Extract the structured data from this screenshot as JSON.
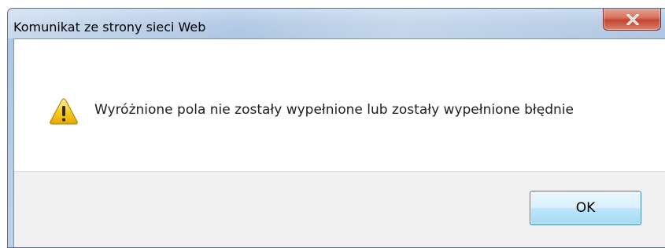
{
  "dialog": {
    "title": "Komunikat ze strony sieci Web",
    "message": "Wyróżnione pola nie zostały wypełnione lub zostały wypełnione błędnie",
    "icon": "warning-icon",
    "ok_label": "OK",
    "close_icon": "close-icon"
  },
  "colors": {
    "frame": "#b5cbe6",
    "close_button": "#c2452f",
    "button_bar": "#f0f0f0",
    "ok_border": "#3c7fb1",
    "warning_fill": "#f5c400"
  }
}
